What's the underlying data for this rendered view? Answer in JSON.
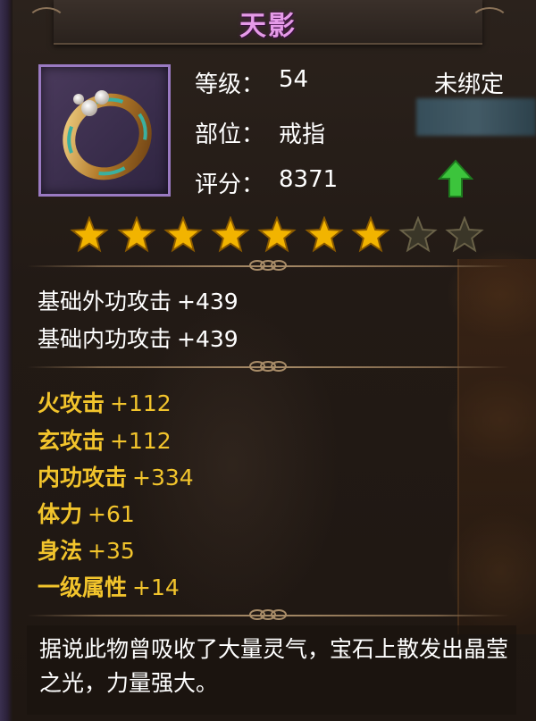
{
  "item": {
    "name": "天影",
    "icon": "ring-icon",
    "level_label": "等级：",
    "level_value": "54",
    "slot_label": "部位：",
    "slot_value": "戒指",
    "score_label": "评分：",
    "score_value": "8371",
    "bind_status": "未绑定",
    "upgrade_indicator": "up-arrow-icon",
    "stars": {
      "filled": 7,
      "total": 9
    }
  },
  "base_attributes": [
    {
      "name": "基础外功攻击",
      "value": "+439"
    },
    {
      "name": "基础内功攻击",
      "value": "+439"
    }
  ],
  "bonus_attributes": [
    {
      "name": "火攻击",
      "value": "+112"
    },
    {
      "name": "玄攻击",
      "value": "+112"
    },
    {
      "name": "内功攻击",
      "value": "+334"
    },
    {
      "name": "体力",
      "value": "+61"
    },
    {
      "name": "身法",
      "value": "+35"
    },
    {
      "name": "一级属性",
      "value": "+14"
    }
  ],
  "description": "据说此物曾吸收了大量灵气，宝石上散发出晶莹之光，力量强大。",
  "colors": {
    "title": "#e59ae8",
    "bonus": "#f2c42c",
    "star": "#f2b400",
    "frame": "#9a7ac2",
    "arrow": "#3cc43c"
  }
}
